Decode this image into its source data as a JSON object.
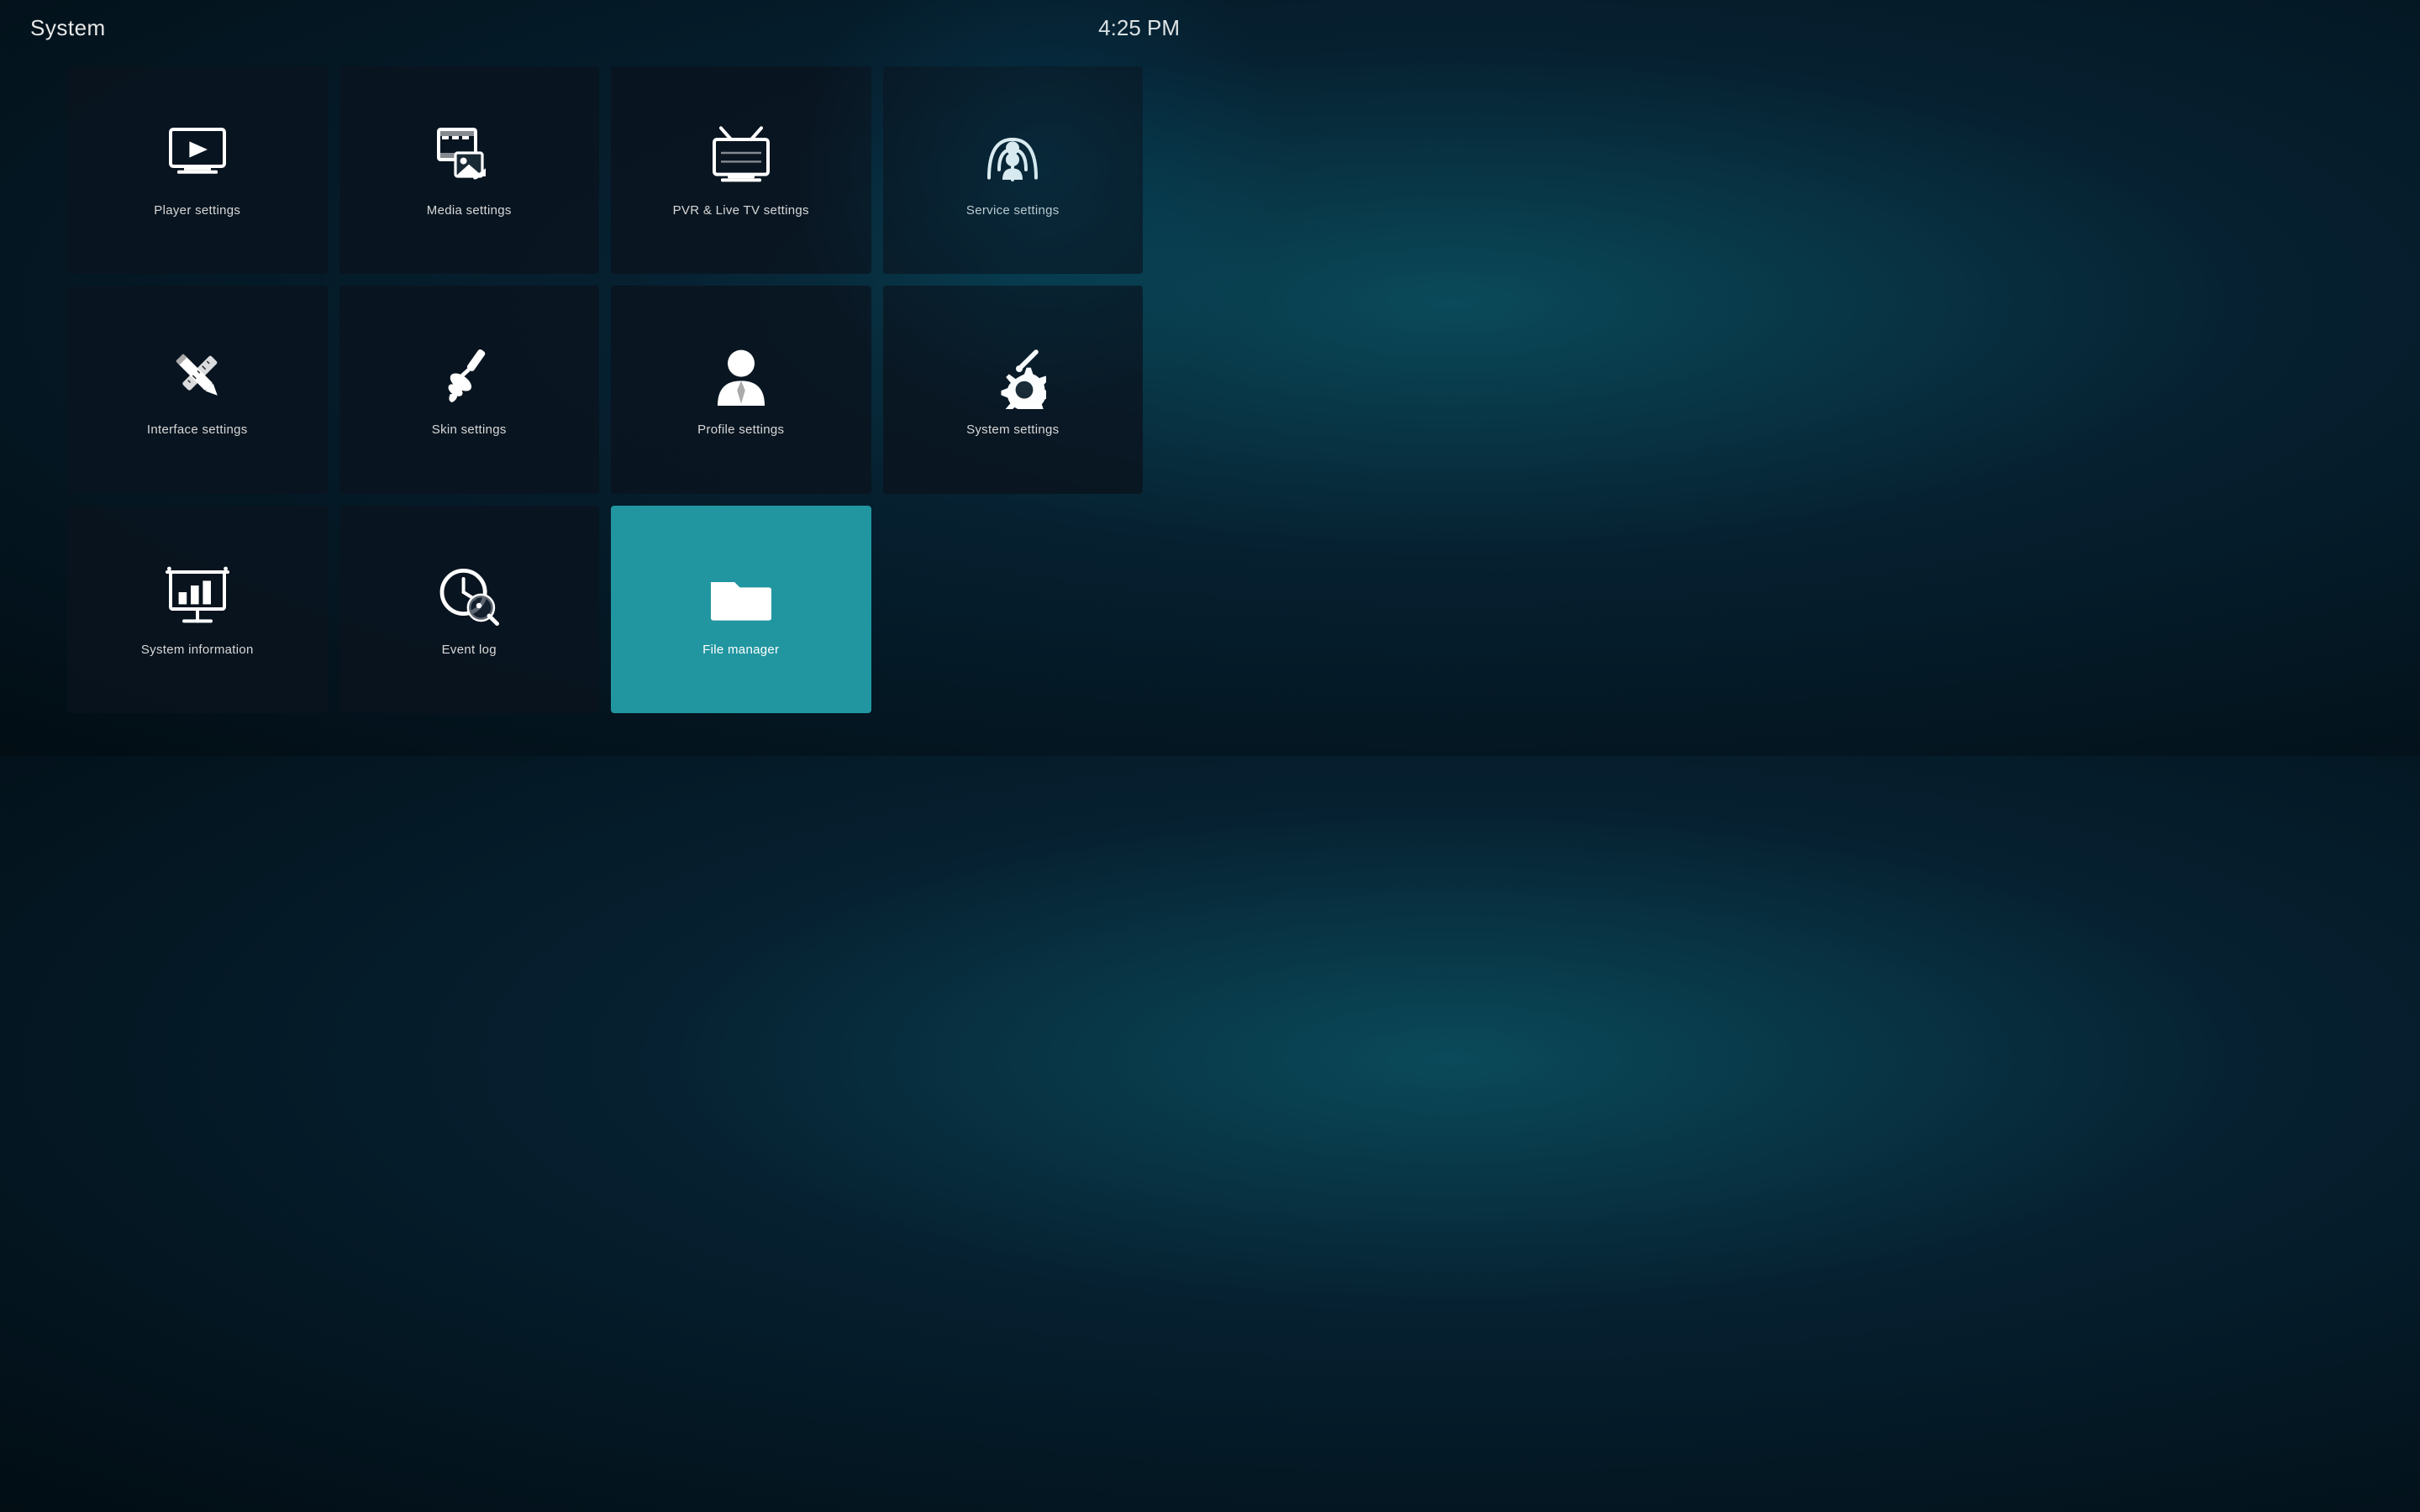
{
  "header": {
    "title": "System",
    "time": "4:25 PM"
  },
  "grid": {
    "items": [
      {
        "id": "player-settings",
        "label": "Player settings",
        "icon": "player",
        "active": false
      },
      {
        "id": "media-settings",
        "label": "Media settings",
        "icon": "media",
        "active": false
      },
      {
        "id": "pvr-settings",
        "label": "PVR & Live TV settings",
        "icon": "pvr",
        "active": false
      },
      {
        "id": "service-settings",
        "label": "Service settings",
        "icon": "service",
        "active": false
      },
      {
        "id": "interface-settings",
        "label": "Interface settings",
        "icon": "interface",
        "active": false
      },
      {
        "id": "skin-settings",
        "label": "Skin settings",
        "icon": "skin",
        "active": false
      },
      {
        "id": "profile-settings",
        "label": "Profile settings",
        "icon": "profile",
        "active": false
      },
      {
        "id": "system-settings",
        "label": "System settings",
        "icon": "system",
        "active": false
      },
      {
        "id": "system-information",
        "label": "System information",
        "icon": "info",
        "active": false
      },
      {
        "id": "event-log",
        "label": "Event log",
        "icon": "eventlog",
        "active": false
      },
      {
        "id": "file-manager",
        "label": "File manager",
        "icon": "filemanager",
        "active": true
      }
    ]
  }
}
